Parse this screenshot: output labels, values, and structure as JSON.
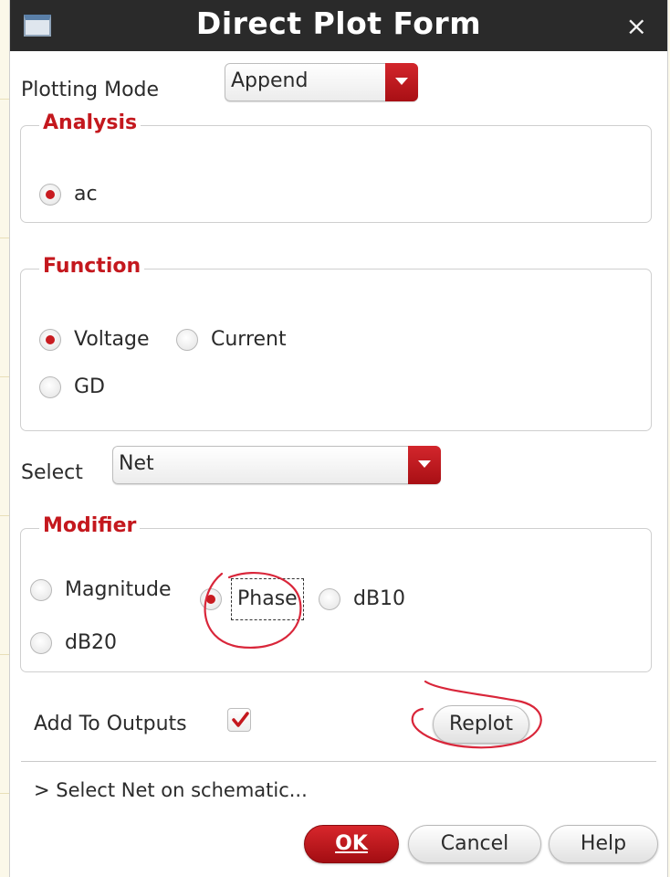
{
  "window": {
    "title": "Direct Plot Form",
    "close_glyph": "×",
    "icon": "window-icon"
  },
  "plotting_mode": {
    "label": "Plotting Mode",
    "value": "Append"
  },
  "analysis": {
    "title": "Analysis",
    "options": [
      {
        "label": "ac",
        "selected": true
      }
    ]
  },
  "function": {
    "title": "Function",
    "options": [
      {
        "label": "Voltage",
        "selected": true
      },
      {
        "label": "Current",
        "selected": false
      },
      {
        "label": "GD",
        "selected": false
      }
    ]
  },
  "select": {
    "label": "Select",
    "value": "Net"
  },
  "modifier": {
    "title": "Modifier",
    "options": [
      {
        "label": "Magnitude",
        "selected": false
      },
      {
        "label": "Phase",
        "selected": true
      },
      {
        "label": "dB10",
        "selected": false
      },
      {
        "label": "dB20",
        "selected": false
      }
    ]
  },
  "add_to_outputs": {
    "label": "Add To Outputs",
    "checked": true
  },
  "replot_label": "Replot",
  "status_text": "> Select Net on schematic...",
  "buttons": {
    "ok_label": "OK",
    "cancel_label": "Cancel",
    "help_label": "Help"
  },
  "colors": {
    "accent_red": "#c4181e",
    "titlebar": "#2a2a2a",
    "annotation_ink": "#d9263a"
  }
}
